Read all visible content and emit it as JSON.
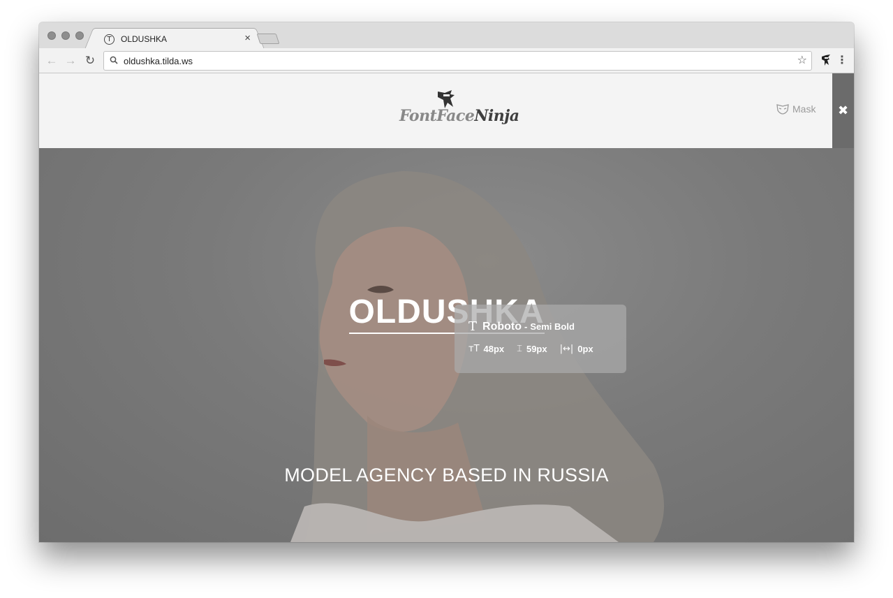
{
  "browser": {
    "tab": {
      "title": "OLDUSHKA",
      "favicon_glyph": "T",
      "close_glyph": "×"
    },
    "url": "oldushka.tilda.ws",
    "nav": {
      "back_icon": "arrow-left-icon",
      "forward_icon": "arrow-right-icon",
      "reload_icon": "reload-icon"
    },
    "bookmark_icon": "star-icon",
    "extension_icon": "ninja-icon",
    "menu_icon": "kebab-menu-icon",
    "glyphs": {
      "back": "←",
      "forward": "→",
      "reload": "↻",
      "star": "☆",
      "menu": "⋮"
    }
  },
  "extension_bar": {
    "logo_text_part1": "FontFace",
    "logo_text_part2": "Ninja",
    "mask_label": "Mask",
    "close_glyph": "✖"
  },
  "hero": {
    "title": "OLDUSHKA",
    "subtitle": "MODEL AGENCY BASED IN RUSSIA"
  },
  "font_tooltip": {
    "font_icon": "T",
    "font_name": "Roboto",
    "separator": "-",
    "font_weight": "Semi Bold",
    "size_icon": "ᴛT",
    "size": "48px",
    "line_height_icon": "⌶",
    "line_height": "59px",
    "spacing_icon": "|↔|",
    "letter_spacing": "0px"
  },
  "colors": {
    "chrome_bg": "#dcdcdc",
    "toolbar_bg": "#f2f2f2",
    "ffn_bar_bg": "#f4f4f4",
    "ffn_close_bg": "#6b6b6b",
    "hero_overlay": "#777777",
    "tooltip_bg": "#aaaaaa"
  }
}
